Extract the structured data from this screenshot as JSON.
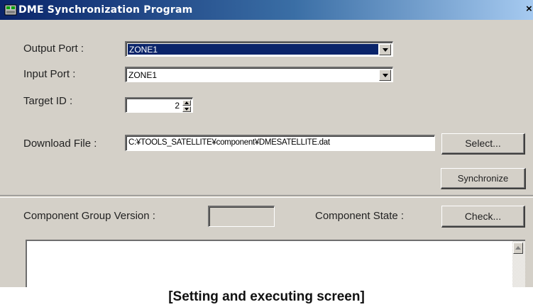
{
  "window": {
    "title": "DME Synchronization Program",
    "close_glyph": "×",
    "icon": "app-icon"
  },
  "form": {
    "output_port_label": "Output Port :",
    "output_port_value": "ZONE1",
    "input_port_label": "Input Port :",
    "input_port_value": "ZONE1",
    "target_id_label": "Target ID :",
    "target_id_value": "2",
    "download_file_label": "Download File :",
    "download_file_value": "C:¥TOOLS_SATELLITE¥component¥DMESATELLITE.dat"
  },
  "buttons": {
    "select": "Select...",
    "synchronize": "Synchronize",
    "check": "Check..."
  },
  "component": {
    "group_version_label": "Component Group Version :",
    "group_version_value": "",
    "state_label": "Component State :"
  },
  "caption": "[Setting and executing screen]",
  "colors": {
    "titlebar_start": "#0a246a",
    "titlebar_end": "#a6caf0",
    "dialog_bg": "#d4d0c8",
    "selection": "#0a246a"
  }
}
